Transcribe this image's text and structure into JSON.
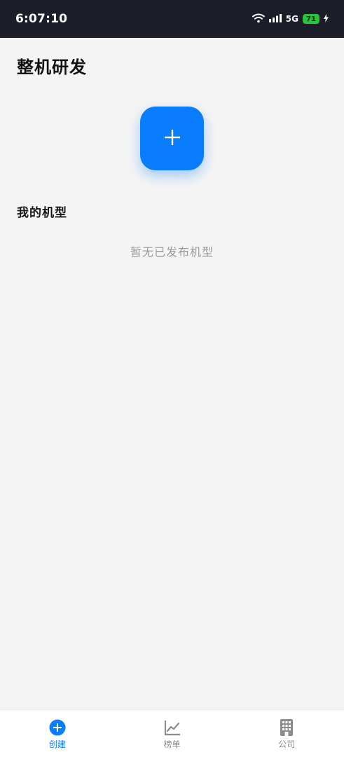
{
  "status_bar": {
    "time": "6:07:10",
    "network": "5G",
    "battery": "71"
  },
  "page": {
    "title": "整机研发",
    "create_icon": "plus-icon",
    "section_title": "我的机型",
    "empty_text": "暂无已发布机型"
  },
  "bottom_nav": {
    "items": [
      {
        "label": "创建",
        "icon": "plus-circle-icon",
        "active": true
      },
      {
        "label": "榜单",
        "icon": "chart-line-icon",
        "active": false
      },
      {
        "label": "公司",
        "icon": "building-icon",
        "active": false
      }
    ]
  },
  "colors": {
    "accent": "#0a7dff",
    "status_bar_bg": "#1b1d28",
    "page_bg": "#f4f4f4",
    "battery": "#2ec23a",
    "inactive": "#8c8c8c"
  }
}
